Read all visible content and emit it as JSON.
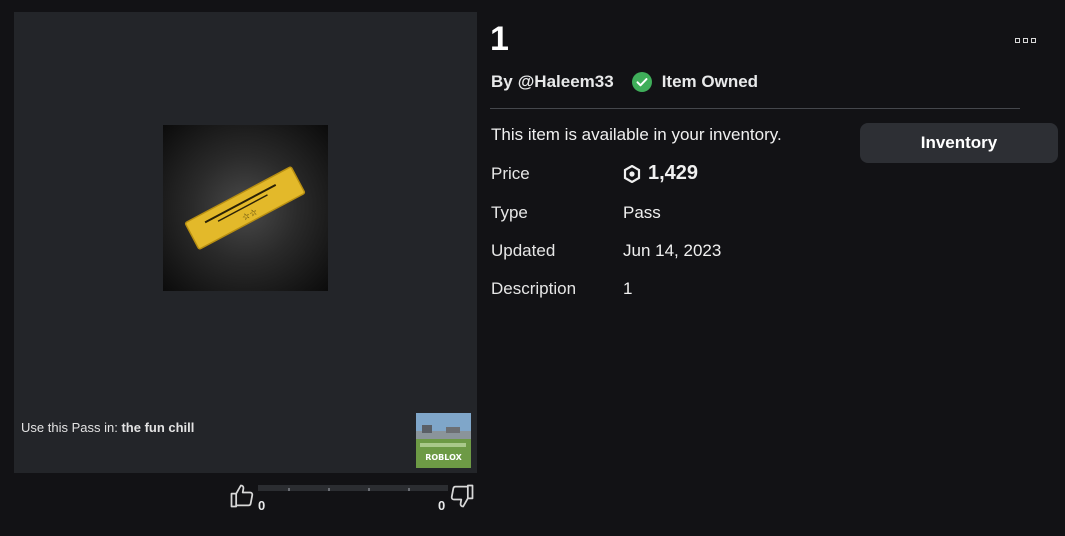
{
  "item": {
    "title": "1",
    "by_prefix": "By",
    "creator": "@Haleem33",
    "owned_label": "Item Owned",
    "availability": "This item is available in your inventory.",
    "inventory_button": "Inventory"
  },
  "details": {
    "price_label": "Price",
    "price_value": "1,429",
    "type_label": "Type",
    "type_value": "Pass",
    "updated_label": "Updated",
    "updated_value": "Jun 14, 2023",
    "description_label": "Description",
    "description_value": "1"
  },
  "usage": {
    "prefix": "Use this Pass in:",
    "place_name": "the fun chill",
    "place_thumb_text": "ROBLOX"
  },
  "votes": {
    "up_count": "0",
    "down_count": "0"
  },
  "colors": {
    "background": "#121215",
    "panel": "#232529",
    "owned_check": "#3fae5a",
    "pass_gold": "#e3b92a"
  },
  "icons": {
    "owned": "check-circle-icon",
    "currency": "robux-icon",
    "more": "more-options-icon",
    "vote_up": "thumbs-up-icon",
    "vote_down": "thumbs-down-icon"
  }
}
